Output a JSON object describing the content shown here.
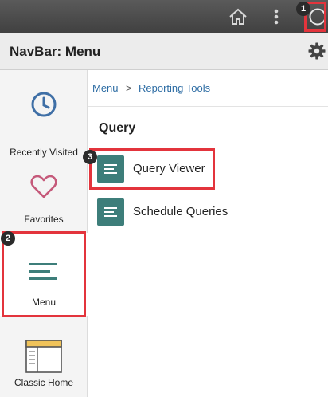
{
  "topbar": {
    "home_icon": "home-icon",
    "actions_icon": "kebab-menu-icon",
    "navbar_icon": "compass-icon"
  },
  "header": {
    "title": "NavBar: Menu",
    "settings_icon": "gear-icon"
  },
  "sidebar": {
    "items": [
      {
        "label": "Recently Visited",
        "icon": "clock-icon"
      },
      {
        "label": "Favorites",
        "icon": "heart-icon"
      },
      {
        "label": "Menu",
        "icon": "menu-lines-icon"
      },
      {
        "label": "Classic Home",
        "icon": "classic-home-icon"
      }
    ]
  },
  "breadcrumb": {
    "root": "Menu",
    "separator": ">",
    "current": "Reporting Tools"
  },
  "section": {
    "title": "Query",
    "items": [
      {
        "label": "Query Viewer"
      },
      {
        "label": "Schedule Queries"
      }
    ]
  },
  "callouts": [
    "1",
    "2",
    "3"
  ],
  "colors": {
    "topbar": "#4a4a4a",
    "accent_teal": "#3d7e7a",
    "link_blue": "#2e6da4",
    "highlight_red": "#e3343c"
  }
}
